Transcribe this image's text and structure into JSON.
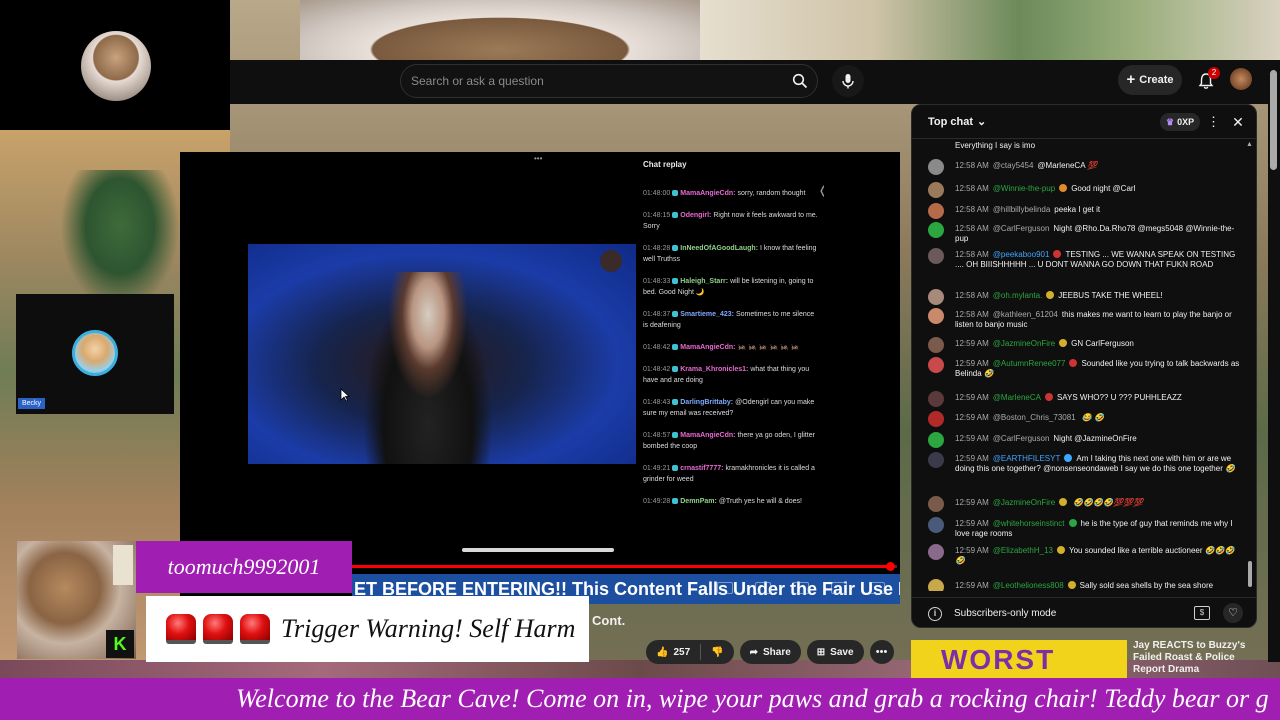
{
  "header": {
    "search_placeholder": "Search or ask a question",
    "create_label": "Create",
    "notification_count": "2"
  },
  "player": {
    "chat_replay_title": "Chat replay",
    "progress": 0.99,
    "replay_messages": [
      {
        "time": "01:48:00",
        "author": "MamaAngieCdn:",
        "author_color": "pink",
        "text": "sorry, random thought"
      },
      {
        "time": "01:48:15",
        "author": "Odengirl:",
        "author_color": "pink",
        "text": "Right now it feels awkward to me. Sorry"
      },
      {
        "time": "01:48:28",
        "author": "InNeedOfAGoodLaugh:",
        "author_color": "green",
        "text": "I know that feeling well Truthss"
      },
      {
        "time": "01:48:33",
        "author": "Haleigh_Starr:",
        "author_color": "green",
        "text": "will be listening in, going to bed. Good Night 🌙"
      },
      {
        "time": "01:48:37",
        "author": "Smartieme_423:",
        "author_color": "blue",
        "text": "Sometimes to me silence is deafening"
      },
      {
        "time": "01:48:42",
        "author": "MamaAngieCdn:",
        "author_color": "pink",
        "text": "🦗 🦗 🦗 🦗 🦗 🦗"
      },
      {
        "time": "01:48:42",
        "author": "Krama_Khronicles1:",
        "author_color": "pink",
        "text": "what that thing you have and are doing"
      },
      {
        "time": "01:48:43",
        "author": "DarlingBrittaby:",
        "author_color": "blue",
        "text": "@Odengirl can you make sure my email was received?"
      },
      {
        "time": "01:48:57",
        "author": "MamaAngieCdn:",
        "author_color": "pink",
        "text": "there ya go oden, I glitter bombed the coop"
      },
      {
        "time": "01:49:21",
        "author": "crnastif7777:",
        "author_color": "pink",
        "text": "kramakhronicles it is called a grinder for weed"
      },
      {
        "time": "01:49:28",
        "author": "DemnPam:",
        "author_color": "green",
        "text": "@Truth yes he will & does!"
      }
    ]
  },
  "title_ticker": "ET BEFORE ENTERING!! This Content Falls Under the Fair Use Disc",
  "video_title_tail": "Cont.",
  "actions": {
    "like_count": "257",
    "share_label": "Share",
    "save_label": "Save"
  },
  "overlays": {
    "cam_label": "Becky",
    "username": "toomuch9992001",
    "warning": "Trigger Warning! Self Harm",
    "kick_letter": "K",
    "welcome": "Welcome to the Bear Cave! Come on in, wipe your paws and grab a rocking chair! Teddy bear or g"
  },
  "chat": {
    "mode_label": "Top chat",
    "xp_label": "0XP",
    "pinned_tail": "Everything I say is imo",
    "messages": [
      {
        "time": "12:58 AM",
        "author": "@ctay5454",
        "author_color": "grey",
        "badge": "",
        "text": "@MarleneCA",
        "emoji": "💯",
        "avatar": "#8a8a8a"
      },
      {
        "time": "12:58 AM",
        "author": "@Winnie-the-pup",
        "author_color": "green",
        "badge": "orange",
        "text": "Good night @Carl",
        "emoji": "",
        "avatar": "#9a7a5a"
      },
      {
        "time": "12:58 AM",
        "author": "@hillbillybelinda",
        "author_color": "grey",
        "badge": "",
        "text": "peeka I get it",
        "emoji": "",
        "avatar": "#b56a4a"
      },
      {
        "time": "12:58 AM",
        "author": "@CarlFerguson",
        "author_color": "grey",
        "badge": "",
        "text": "Night @Rho.Da.Rho78 @megs5048 @Winnie-the-pup",
        "emoji": "",
        "avatar": "#2ba640"
      },
      {
        "time": "12:58 AM",
        "author": "@peekaboo901",
        "author_color": "blue",
        "badge": "red",
        "text": "TESTING ... WE WANNA SPEAK ON TESTING .... OH BIIISHHHHH ... U DONT WANNA GO DOWN THAT FUKN ROAD",
        "emoji": "",
        "avatar": "#6a5a5a"
      },
      {
        "time": "12:58 AM",
        "author": "@oh.mylanta.",
        "author_color": "green",
        "badge": "yellow",
        "text": "JEEBUS TAKE THE WHEEL!",
        "emoji": "",
        "avatar": "#a88a7a"
      },
      {
        "time": "12:58 AM",
        "author": "@kathleen_61204",
        "author_color": "grey",
        "badge": "",
        "text": "this makes me want to learn to play the banjo or listen to banjo music",
        "emoji": "",
        "avatar": "#c88a6a"
      },
      {
        "time": "12:59 AM",
        "author": "@JazmineOnFire",
        "author_color": "green",
        "badge": "yellow",
        "text": "GN CarlFerguson",
        "emoji": "",
        "avatar": "#7a5a4a"
      },
      {
        "time": "12:59 AM",
        "author": "@AutumnRenee077",
        "author_color": "green",
        "badge": "red",
        "text": "Sounded like you trying to talk backwards as Belinda",
        "emoji": "🤣",
        "avatar": "#c84a4a"
      },
      {
        "time": "12:59 AM",
        "author": "@MarleneCA",
        "author_color": "green",
        "badge": "red",
        "text": "SAYS WHO?? U ??? PUHHLEAZZ",
        "emoji": "",
        "avatar": "#5a3a3a"
      },
      {
        "time": "12:59 AM",
        "author": "@Boston_Chris_73081",
        "author_color": "grey",
        "badge": "",
        "text": "",
        "emoji": "😂 🤣",
        "avatar": "#b02a2a"
      },
      {
        "time": "12:59 AM",
        "author": "@CarlFerguson",
        "author_color": "grey",
        "badge": "",
        "text": "Night @JazmineOnFire",
        "emoji": "",
        "avatar": "#2ba640"
      },
      {
        "time": "12:59 AM",
        "author": "@EARTHFILESYT",
        "author_color": "blue",
        "badge": "blue",
        "text": "Am I taking this next one with him or are we doing this one together? @nonsenseondaweb I say we do this one together",
        "emoji": "🤣",
        "avatar": "#3a3a4a"
      },
      {
        "time": "12:59 AM",
        "author": "@JazmineOnFire",
        "author_color": "green",
        "badge": "yellow",
        "text": "",
        "emoji": "🤣🤣🤣🤣💯💯💯",
        "avatar": "#7a5a4a"
      },
      {
        "time": "12:59 AM",
        "author": "@whitehorseinstinct",
        "author_color": "green",
        "badge": "green",
        "text": "he is the type of guy that reminds me why I love rage rooms",
        "emoji": "",
        "avatar": "#4a5a7a"
      },
      {
        "time": "12:59 AM",
        "author": "@ElizabethH_13",
        "author_color": "green",
        "badge": "yellow",
        "text": "You sounded like a terrible auctioneer",
        "emoji": "🤣🤣🤣🤣",
        "avatar": "#8a6a8a"
      },
      {
        "time": "12:59 AM",
        "author": "@Leothelioness808",
        "author_color": "green",
        "badge": "yellow",
        "text": "Sally sold sea shells by the sea shore",
        "emoji": "",
        "avatar": "#c8a84a"
      }
    ],
    "footer_label": "Subscribers-only mode"
  },
  "recommendation": {
    "thumb_text": "WORST",
    "title": "Jay REACTS to Buzzy's Failed Roast & Police Report Drama"
  },
  "colors": {
    "brand_purple": "#a11eb3",
    "yt_red": "#ff0000",
    "ticker_blue": "#1d4fa0"
  }
}
